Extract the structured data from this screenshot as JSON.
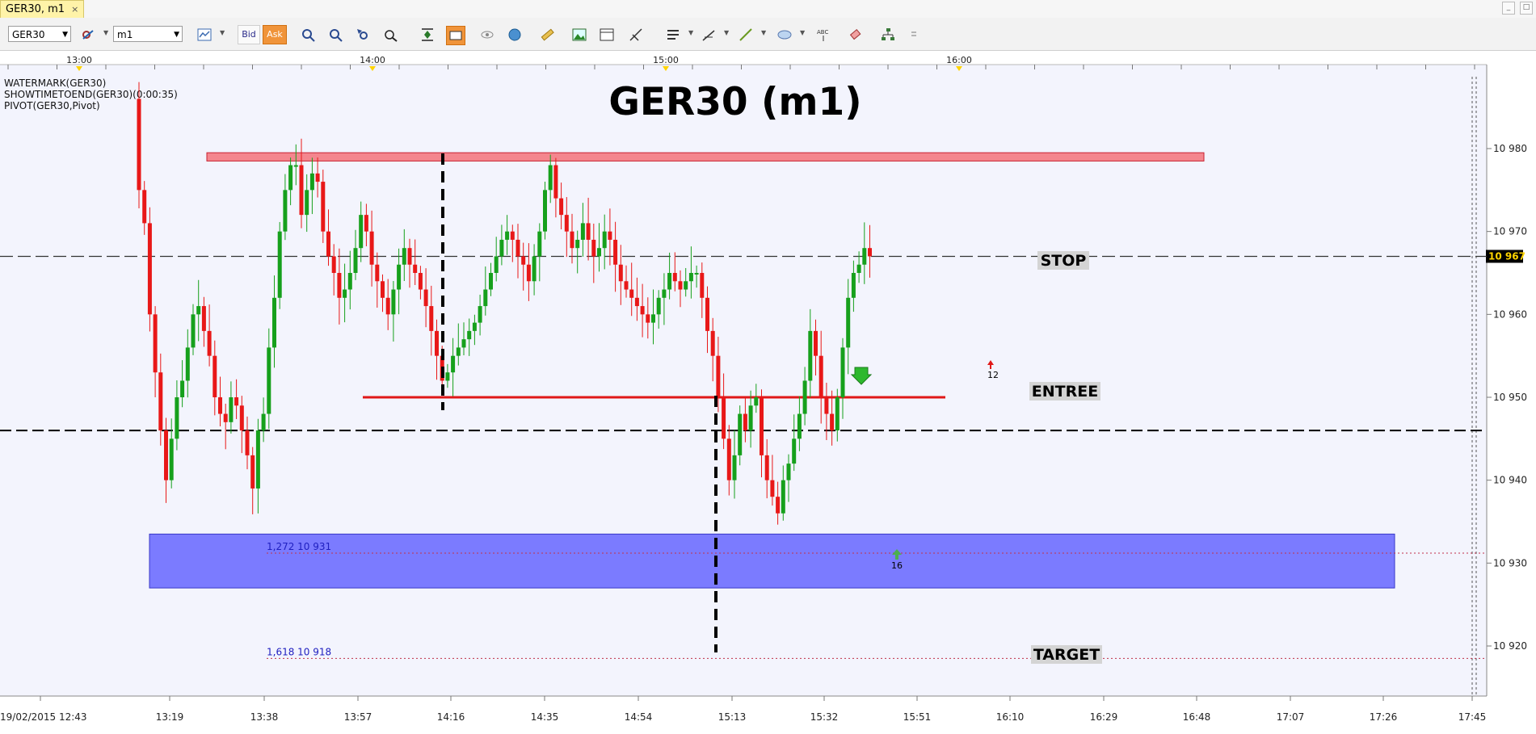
{
  "window": {
    "tab_title": "GER30, m1",
    "close_label": "×",
    "win_controls": [
      "_",
      "□"
    ]
  },
  "toolbar": {
    "symbol": "GER30",
    "timeframe": "m1",
    "bid_label": "Bid",
    "ask_label": "Ask",
    "abc_label": "ABC"
  },
  "indicators": [
    "WATERMARK(GER30)",
    "SHOWTIMETOEND(GER30)(0:00:35)",
    "PIVOT(GER30,Pivot)"
  ],
  "chart_data": {
    "type": "candlestick",
    "title": "GER30 (m1)",
    "y_ticks": [
      {
        "v": 10980,
        "label": "10 980"
      },
      {
        "v": 10970,
        "label": "10 970"
      },
      {
        "v": 10960,
        "label": "10 960"
      },
      {
        "v": 10950,
        "label": "10 950"
      },
      {
        "v": 10940,
        "label": "10 940"
      },
      {
        "v": 10930,
        "label": "10 930"
      },
      {
        "v": 10920,
        "label": "10 920"
      }
    ],
    "current_price": {
      "v": 10967,
      "label": "10 967"
    },
    "top_time_labels": [
      "13:00",
      "14:00",
      "15:00",
      "16:00"
    ],
    "bottom_time_labels": [
      "19/02/2015 12:43",
      "13:19",
      "13:38",
      "13:57",
      "14:16",
      "14:35",
      "14:54",
      "15:13",
      "15:32",
      "15:51",
      "16:10",
      "16:29",
      "16:48",
      "17:07",
      "17:26",
      "17:45"
    ],
    "levels": [
      {
        "label": "STOP",
        "v": 10967
      },
      {
        "label": "ENTREE",
        "v": 10950
      },
      {
        "label": "TARGET",
        "v": 10920
      }
    ],
    "fib_labels": [
      {
        "label": "1,272 10 931",
        "v": 10931.2
      },
      {
        "label": "1,618 10 918",
        "v": 10918.5
      }
    ],
    "markers": [
      {
        "label": "12",
        "type": "sell-arrow"
      },
      {
        "label": "16",
        "type": "buy-arrow"
      }
    ],
    "resistance_zone": [
      10978.5,
      10979.5
    ],
    "support_zone": [
      10927,
      10933.5
    ],
    "dashed_level": 10946,
    "closes": [
      10975,
      10971,
      10960,
      10953,
      10946,
      10940,
      10945,
      10950,
      10952,
      10956,
      10960,
      10961,
      10958,
      10955,
      10950,
      10948,
      10947,
      10950,
      10949,
      10946,
      10943,
      10939,
      10946,
      10948,
      10956,
      10962,
      10970,
      10975,
      10978,
      10978,
      10972,
      10975,
      10977,
      10976,
      10970,
      10967,
      10965,
      10962,
      10963,
      10965,
      10968,
      10972,
      10970,
      10966,
      10964,
      10962,
      10960,
      10963,
      10966,
      10968,
      10966,
      10965,
      10963,
      10961,
      10958,
      10955,
      10952,
      10953,
      10955,
      10956,
      10957,
      10958,
      10959,
      10961,
      10963,
      10965,
      10967,
      10969,
      10970,
      10969,
      10967,
      10966,
      10964,
      10967,
      10970,
      10975,
      10978,
      10974,
      10972,
      10970,
      10968,
      10969,
      10971,
      10969,
      10967,
      10968,
      10970,
      10969,
      10966,
      10964,
      10963,
      10962,
      10961,
      10960,
      10959,
      10960,
      10962,
      10963,
      10965,
      10964,
      10963,
      10964,
      10965,
      10965,
      10962,
      10958,
      10955,
      10950,
      10945,
      10940,
      10943,
      10948,
      10946,
      10949,
      10950,
      10943,
      10940,
      10938,
      10936,
      10940,
      10942,
      10945,
      10948,
      10952,
      10958,
      10955,
      10950,
      10948,
      10946,
      10950,
      10956,
      10962,
      10965,
      10966,
      10968,
      10967
    ]
  }
}
